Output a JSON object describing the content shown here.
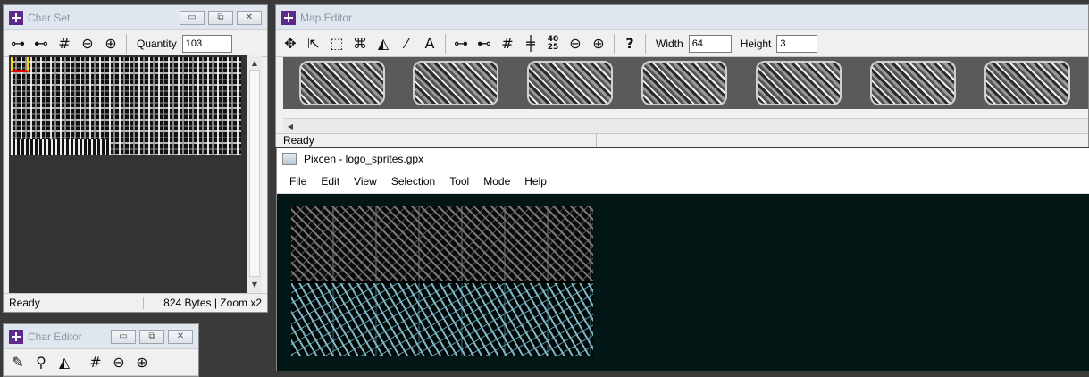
{
  "char_set": {
    "title": "Char Set",
    "quantity_label": "Quantity",
    "quantity_value": "103",
    "status": "Ready",
    "info": "824 Bytes | Zoom x2"
  },
  "map_editor": {
    "title": "Map Editor",
    "width_label": "Width",
    "width_value": "64",
    "height_label": "Height",
    "height_value": "3",
    "status": "Ready",
    "ruler_tool": "40 25"
  },
  "pixcen": {
    "title": "Pixcen - logo_sprites.gpx",
    "menu": [
      "File",
      "Edit",
      "View",
      "Selection",
      "Tool",
      "Mode",
      "Help"
    ]
  },
  "char_editor": {
    "title": "Char Editor"
  },
  "window_buttons": {
    "minimize": "▭",
    "restore": "⧉",
    "close": "✕"
  },
  "colors": {
    "desktop": "#3a3a3a",
    "pixcen_canvas": "#031616",
    "sprite_cyan": "#7fb7c4",
    "accent_purple": "#5b2a8c"
  }
}
